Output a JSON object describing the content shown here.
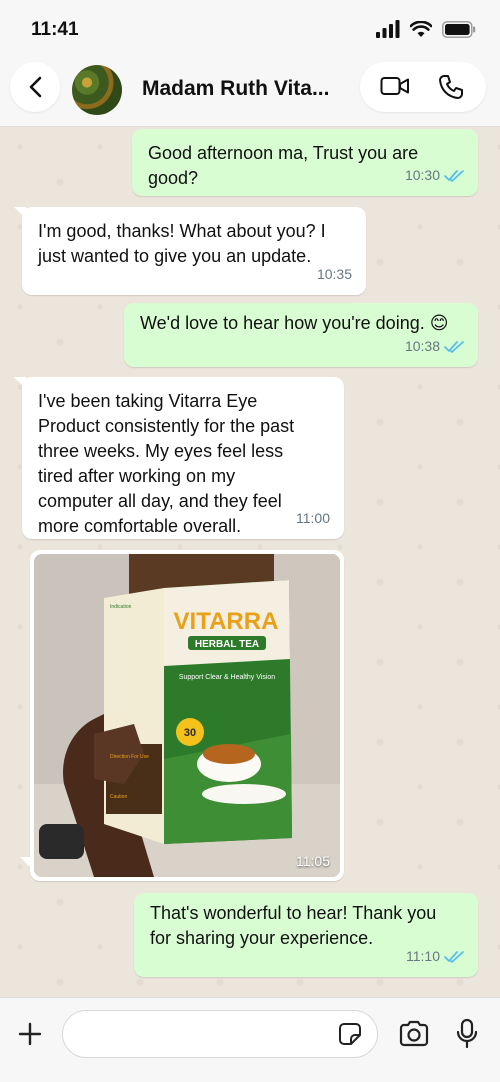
{
  "status_bar": {
    "time": "11:41"
  },
  "header": {
    "contact_name": "Madam Ruth Vita..."
  },
  "messages": [
    {
      "direction": "out",
      "text": "Good afternoon ma, Trust you are good?",
      "time": "10:30"
    },
    {
      "direction": "in",
      "text": "I'm good, thanks! What about you? I just wanted to give you an update.",
      "time": "10:35"
    },
    {
      "direction": "out",
      "text": "We'd love to hear how you're doing. 😊",
      "time": "10:38"
    },
    {
      "direction": "in",
      "text": "I've been taking Vitarra Eye Product consistently for the past three weeks. My eyes feel less tired after working on my computer all day, and they feel more comfortable overall.",
      "time": "11:00"
    },
    {
      "direction": "in",
      "type": "image",
      "time": "11:05",
      "product": {
        "brand": "VITARRA",
        "subtitle": "HERBAL TEA",
        "tagline": "Support Clear & Healthy Vision",
        "count": "30",
        "side_heading": "Indication",
        "side_heading2": "Direction For Use",
        "side_heading3": "Caution"
      }
    },
    {
      "direction": "out",
      "text": "That's wonderful to hear! Thank you for sharing your experience.",
      "time": "11:10"
    }
  ],
  "composer": {
    "placeholder": ""
  },
  "colors": {
    "outgoing": "#d9fdd3",
    "incoming": "#ffffff",
    "read_ticks": "#53bdeb",
    "background": "#efeae2"
  }
}
